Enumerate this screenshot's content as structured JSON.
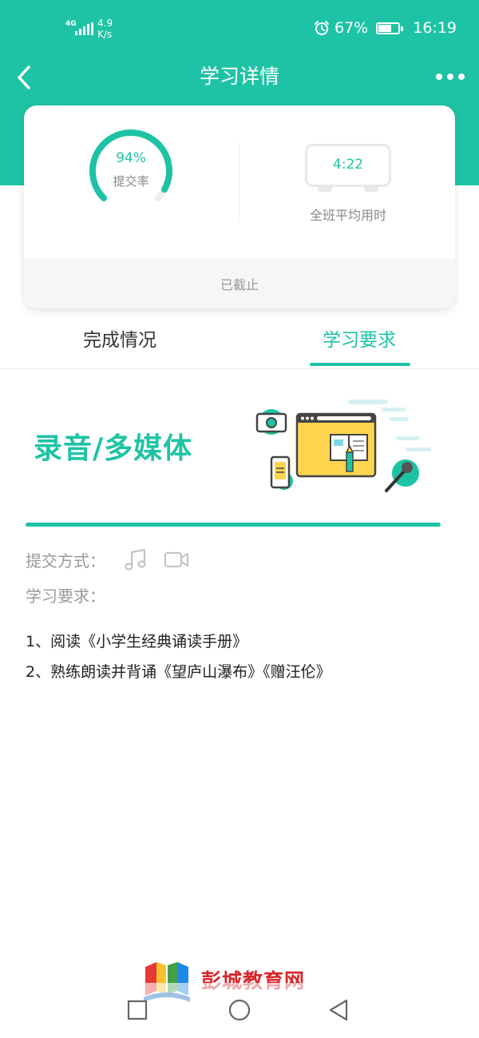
{
  "status_bar": {
    "network": "4G",
    "speed_value": "4.9",
    "speed_unit": "K/s",
    "battery_percent": "67%",
    "time": "16:19",
    "icons": [
      "signal-icon",
      "alarm-icon",
      "battery-icon"
    ]
  },
  "header": {
    "title": "学习详情",
    "back_icon": "chevron-left-icon",
    "more_icon": "more-dots-icon"
  },
  "stats": {
    "submit_rate_value": "94%",
    "submit_rate_fraction": 0.94,
    "submit_rate_label": "提交率",
    "avg_time_value": "4:22",
    "avg_time_label": "全班平均用时",
    "deadline_status": "已截止"
  },
  "tabs": [
    {
      "label": "完成情况",
      "active": false
    },
    {
      "label": "学习要求",
      "active": true
    }
  ],
  "assignment": {
    "type_title": "录音/多媒体",
    "submit_method_label": "提交方式：",
    "submit_method_icons": [
      "music-note-icon",
      "video-camera-icon"
    ],
    "requirements_label": "学习要求：",
    "requirements": [
      "1、阅读《小学生经典诵读手册》",
      "2、熟练朗读并背诵《望庐山瀑布》《赠汪伦》"
    ]
  },
  "watermark": {
    "text": "彭城教育网"
  },
  "system_nav": {
    "icons": [
      "recent-apps-icon",
      "home-icon",
      "back-triangle-icon"
    ]
  },
  "colors": {
    "accent": "#1ec3a5",
    "text_primary": "#222222",
    "text_secondary": "#999999",
    "watermark_red": "#d8252a"
  }
}
